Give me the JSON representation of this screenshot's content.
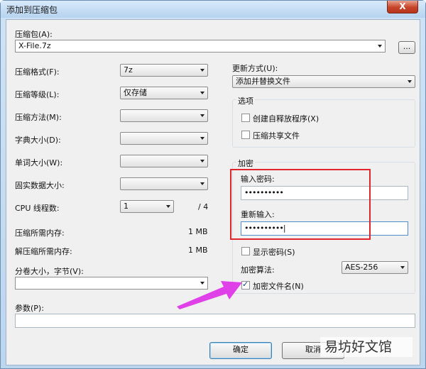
{
  "window": {
    "title": "添加到压缩包",
    "close_glyph": "X"
  },
  "archive": {
    "label": "压缩包(A):",
    "value": "X-File.7z",
    "browse_label": "..."
  },
  "left": {
    "format": {
      "label": "压缩格式(F):",
      "value": "7z"
    },
    "level": {
      "label": "压缩等级(L):",
      "value": "仅存储"
    },
    "method": {
      "label": "压缩方法(M):",
      "value": ""
    },
    "dict": {
      "label": "字典大小(D):",
      "value": ""
    },
    "word": {
      "label": "单词大小(W):",
      "value": ""
    },
    "solid": {
      "label": "固实数据大小:",
      "value": ""
    },
    "threads": {
      "label": "CPU 线程数:",
      "value": "1",
      "max": "/ 4"
    },
    "mem_compress": {
      "label": "压缩所需内存:",
      "value": "1 MB"
    },
    "mem_decompress": {
      "label": "解压缩所需内存:",
      "value": "1 MB"
    },
    "split": {
      "label": "分卷大小，字节(V):",
      "value": ""
    },
    "params": {
      "label": "参数(P):",
      "value": ""
    }
  },
  "right": {
    "update": {
      "label": "更新方式(U):",
      "value": "添加并替换文件"
    },
    "options": {
      "title": "选项",
      "sfx": {
        "label": "创建自释放程序(X)",
        "checked": false
      },
      "shared": {
        "label": "压缩共享文件",
        "checked": false
      }
    },
    "encryption": {
      "title": "加密",
      "password_label": "输入密码:",
      "password_value": "••••••••••",
      "reenter_label": "重新输入:",
      "reenter_value": "••••••••••|",
      "show_password": {
        "label": "显示密码(S)",
        "checked": false
      },
      "method_label": "加密算法:",
      "method_value": "AES-256",
      "encrypt_names": {
        "label": "加密文件名(N)",
        "checked": true
      }
    }
  },
  "buttons": {
    "ok": "确定",
    "cancel": "取消"
  },
  "watermark": "易坊好文馆",
  "colors": {
    "highlight_box": "#e0262b",
    "arrow": "#e040e8"
  }
}
